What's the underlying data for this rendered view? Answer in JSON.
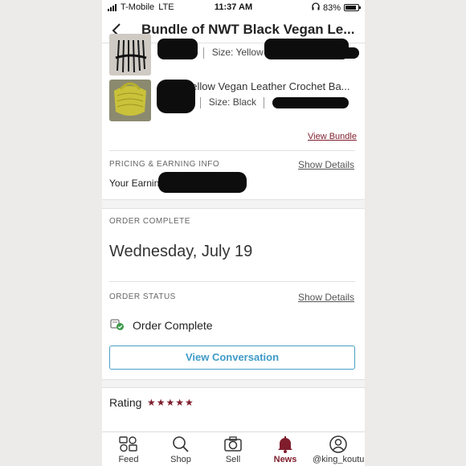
{
  "status_bar": {
    "carrier": "T-Mobile",
    "network": "LTE",
    "time": "11:37 AM",
    "battery": "83%"
  },
  "header": {
    "title": "Bundle of NWT Black Vegan Le..."
  },
  "items": [
    {
      "title": "",
      "size": "Size: Yellow"
    },
    {
      "title": "NWT Yellow Vegan Leather Crochet Ba...",
      "size": "Size: Black"
    }
  ],
  "view_bundle": "View Bundle",
  "pricing": {
    "label": "PRICING & EARNING INFO",
    "show_details": "Show Details",
    "earnings_label": "Your Earnings:"
  },
  "order_complete": {
    "label": "ORDER COMPLETE",
    "date": "Wednesday, July 19"
  },
  "order_status": {
    "label": "ORDER STATUS",
    "show_details": "Show Details",
    "status": "Order Complete",
    "button": "View Conversation"
  },
  "rating": {
    "label": "Rating",
    "stars": "★★★★★",
    "value": 5
  },
  "tabs": [
    {
      "label": "Feed",
      "icon": "feed-icon"
    },
    {
      "label": "Shop",
      "icon": "search-icon"
    },
    {
      "label": "Sell",
      "icon": "camera-icon"
    },
    {
      "label": "News",
      "icon": "bell-icon"
    },
    {
      "label": "@king_kouture",
      "icon": "profile-icon"
    }
  ],
  "colors": {
    "accent": "#7f1d2d",
    "button_blue": "#3e9bc7"
  }
}
